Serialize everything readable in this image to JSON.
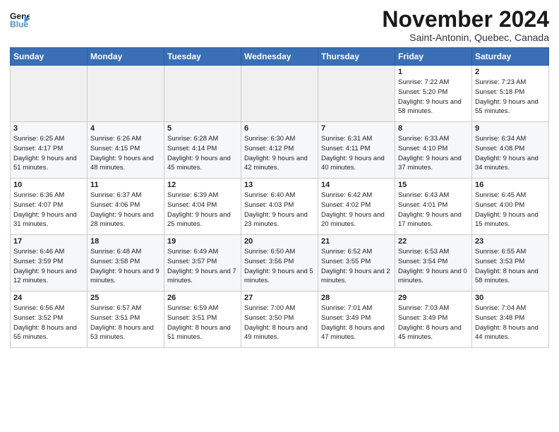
{
  "logo": {
    "line1": "General",
    "line2": "Blue",
    "arrow_color": "#4a90d9"
  },
  "title": "November 2024",
  "location": "Saint-Antonin, Quebec, Canada",
  "days_of_week": [
    "Sunday",
    "Monday",
    "Tuesday",
    "Wednesday",
    "Thursday",
    "Friday",
    "Saturday"
  ],
  "weeks": [
    {
      "days": [
        {
          "num": "",
          "empty": true
        },
        {
          "num": "",
          "empty": true
        },
        {
          "num": "",
          "empty": true
        },
        {
          "num": "",
          "empty": true
        },
        {
          "num": "",
          "empty": true
        },
        {
          "num": "1",
          "sunrise": "Sunrise: 7:22 AM",
          "sunset": "Sunset: 5:20 PM",
          "daylight": "Daylight: 9 hours and 58 minutes."
        },
        {
          "num": "2",
          "sunrise": "Sunrise: 7:23 AM",
          "sunset": "Sunset: 5:18 PM",
          "daylight": "Daylight: 9 hours and 55 minutes."
        }
      ]
    },
    {
      "days": [
        {
          "num": "3",
          "sunrise": "Sunrise: 6:25 AM",
          "sunset": "Sunset: 4:17 PM",
          "daylight": "Daylight: 9 hours and 51 minutes."
        },
        {
          "num": "4",
          "sunrise": "Sunrise: 6:26 AM",
          "sunset": "Sunset: 4:15 PM",
          "daylight": "Daylight: 9 hours and 48 minutes."
        },
        {
          "num": "5",
          "sunrise": "Sunrise: 6:28 AM",
          "sunset": "Sunset: 4:14 PM",
          "daylight": "Daylight: 9 hours and 45 minutes."
        },
        {
          "num": "6",
          "sunrise": "Sunrise: 6:30 AM",
          "sunset": "Sunset: 4:12 PM",
          "daylight": "Daylight: 9 hours and 42 minutes."
        },
        {
          "num": "7",
          "sunrise": "Sunrise: 6:31 AM",
          "sunset": "Sunset: 4:11 PM",
          "daylight": "Daylight: 9 hours and 40 minutes."
        },
        {
          "num": "8",
          "sunrise": "Sunrise: 6:33 AM",
          "sunset": "Sunset: 4:10 PM",
          "daylight": "Daylight: 9 hours and 37 minutes."
        },
        {
          "num": "9",
          "sunrise": "Sunrise: 6:34 AM",
          "sunset": "Sunset: 4:08 PM",
          "daylight": "Daylight: 9 hours and 34 minutes."
        }
      ]
    },
    {
      "days": [
        {
          "num": "10",
          "sunrise": "Sunrise: 6:36 AM",
          "sunset": "Sunset: 4:07 PM",
          "daylight": "Daylight: 9 hours and 31 minutes."
        },
        {
          "num": "11",
          "sunrise": "Sunrise: 6:37 AM",
          "sunset": "Sunset: 4:06 PM",
          "daylight": "Daylight: 9 hours and 28 minutes."
        },
        {
          "num": "12",
          "sunrise": "Sunrise: 6:39 AM",
          "sunset": "Sunset: 4:04 PM",
          "daylight": "Daylight: 9 hours and 25 minutes."
        },
        {
          "num": "13",
          "sunrise": "Sunrise: 6:40 AM",
          "sunset": "Sunset: 4:03 PM",
          "daylight": "Daylight: 9 hours and 23 minutes."
        },
        {
          "num": "14",
          "sunrise": "Sunrise: 6:42 AM",
          "sunset": "Sunset: 4:02 PM",
          "daylight": "Daylight: 9 hours and 20 minutes."
        },
        {
          "num": "15",
          "sunrise": "Sunrise: 6:43 AM",
          "sunset": "Sunset: 4:01 PM",
          "daylight": "Daylight: 9 hours and 17 minutes."
        },
        {
          "num": "16",
          "sunrise": "Sunrise: 6:45 AM",
          "sunset": "Sunset: 4:00 PM",
          "daylight": "Daylight: 9 hours and 15 minutes."
        }
      ]
    },
    {
      "days": [
        {
          "num": "17",
          "sunrise": "Sunrise: 6:46 AM",
          "sunset": "Sunset: 3:59 PM",
          "daylight": "Daylight: 9 hours and 12 minutes."
        },
        {
          "num": "18",
          "sunrise": "Sunrise: 6:48 AM",
          "sunset": "Sunset: 3:58 PM",
          "daylight": "Daylight: 9 hours and 9 minutes."
        },
        {
          "num": "19",
          "sunrise": "Sunrise: 6:49 AM",
          "sunset": "Sunset: 3:57 PM",
          "daylight": "Daylight: 9 hours and 7 minutes."
        },
        {
          "num": "20",
          "sunrise": "Sunrise: 6:50 AM",
          "sunset": "Sunset: 3:56 PM",
          "daylight": "Daylight: 9 hours and 5 minutes."
        },
        {
          "num": "21",
          "sunrise": "Sunrise: 6:52 AM",
          "sunset": "Sunset: 3:55 PM",
          "daylight": "Daylight: 9 hours and 2 minutes."
        },
        {
          "num": "22",
          "sunrise": "Sunrise: 6:53 AM",
          "sunset": "Sunset: 3:54 PM",
          "daylight": "Daylight: 9 hours and 0 minutes."
        },
        {
          "num": "23",
          "sunrise": "Sunrise: 6:55 AM",
          "sunset": "Sunset: 3:53 PM",
          "daylight": "Daylight: 8 hours and 58 minutes."
        }
      ]
    },
    {
      "days": [
        {
          "num": "24",
          "sunrise": "Sunrise: 6:56 AM",
          "sunset": "Sunset: 3:52 PM",
          "daylight": "Daylight: 8 hours and 55 minutes."
        },
        {
          "num": "25",
          "sunrise": "Sunrise: 6:57 AM",
          "sunset": "Sunset: 3:51 PM",
          "daylight": "Daylight: 8 hours and 53 minutes."
        },
        {
          "num": "26",
          "sunrise": "Sunrise: 6:59 AM",
          "sunset": "Sunset: 3:51 PM",
          "daylight": "Daylight: 8 hours and 51 minutes."
        },
        {
          "num": "27",
          "sunrise": "Sunrise: 7:00 AM",
          "sunset": "Sunset: 3:50 PM",
          "daylight": "Daylight: 8 hours and 49 minutes."
        },
        {
          "num": "28",
          "sunrise": "Sunrise: 7:01 AM",
          "sunset": "Sunset: 3:49 PM",
          "daylight": "Daylight: 8 hours and 47 minutes."
        },
        {
          "num": "29",
          "sunrise": "Sunrise: 7:03 AM",
          "sunset": "Sunset: 3:49 PM",
          "daylight": "Daylight: 8 hours and 45 minutes."
        },
        {
          "num": "30",
          "sunrise": "Sunrise: 7:04 AM",
          "sunset": "Sunset: 3:48 PM",
          "daylight": "Daylight: 8 hours and 44 minutes."
        }
      ]
    }
  ]
}
